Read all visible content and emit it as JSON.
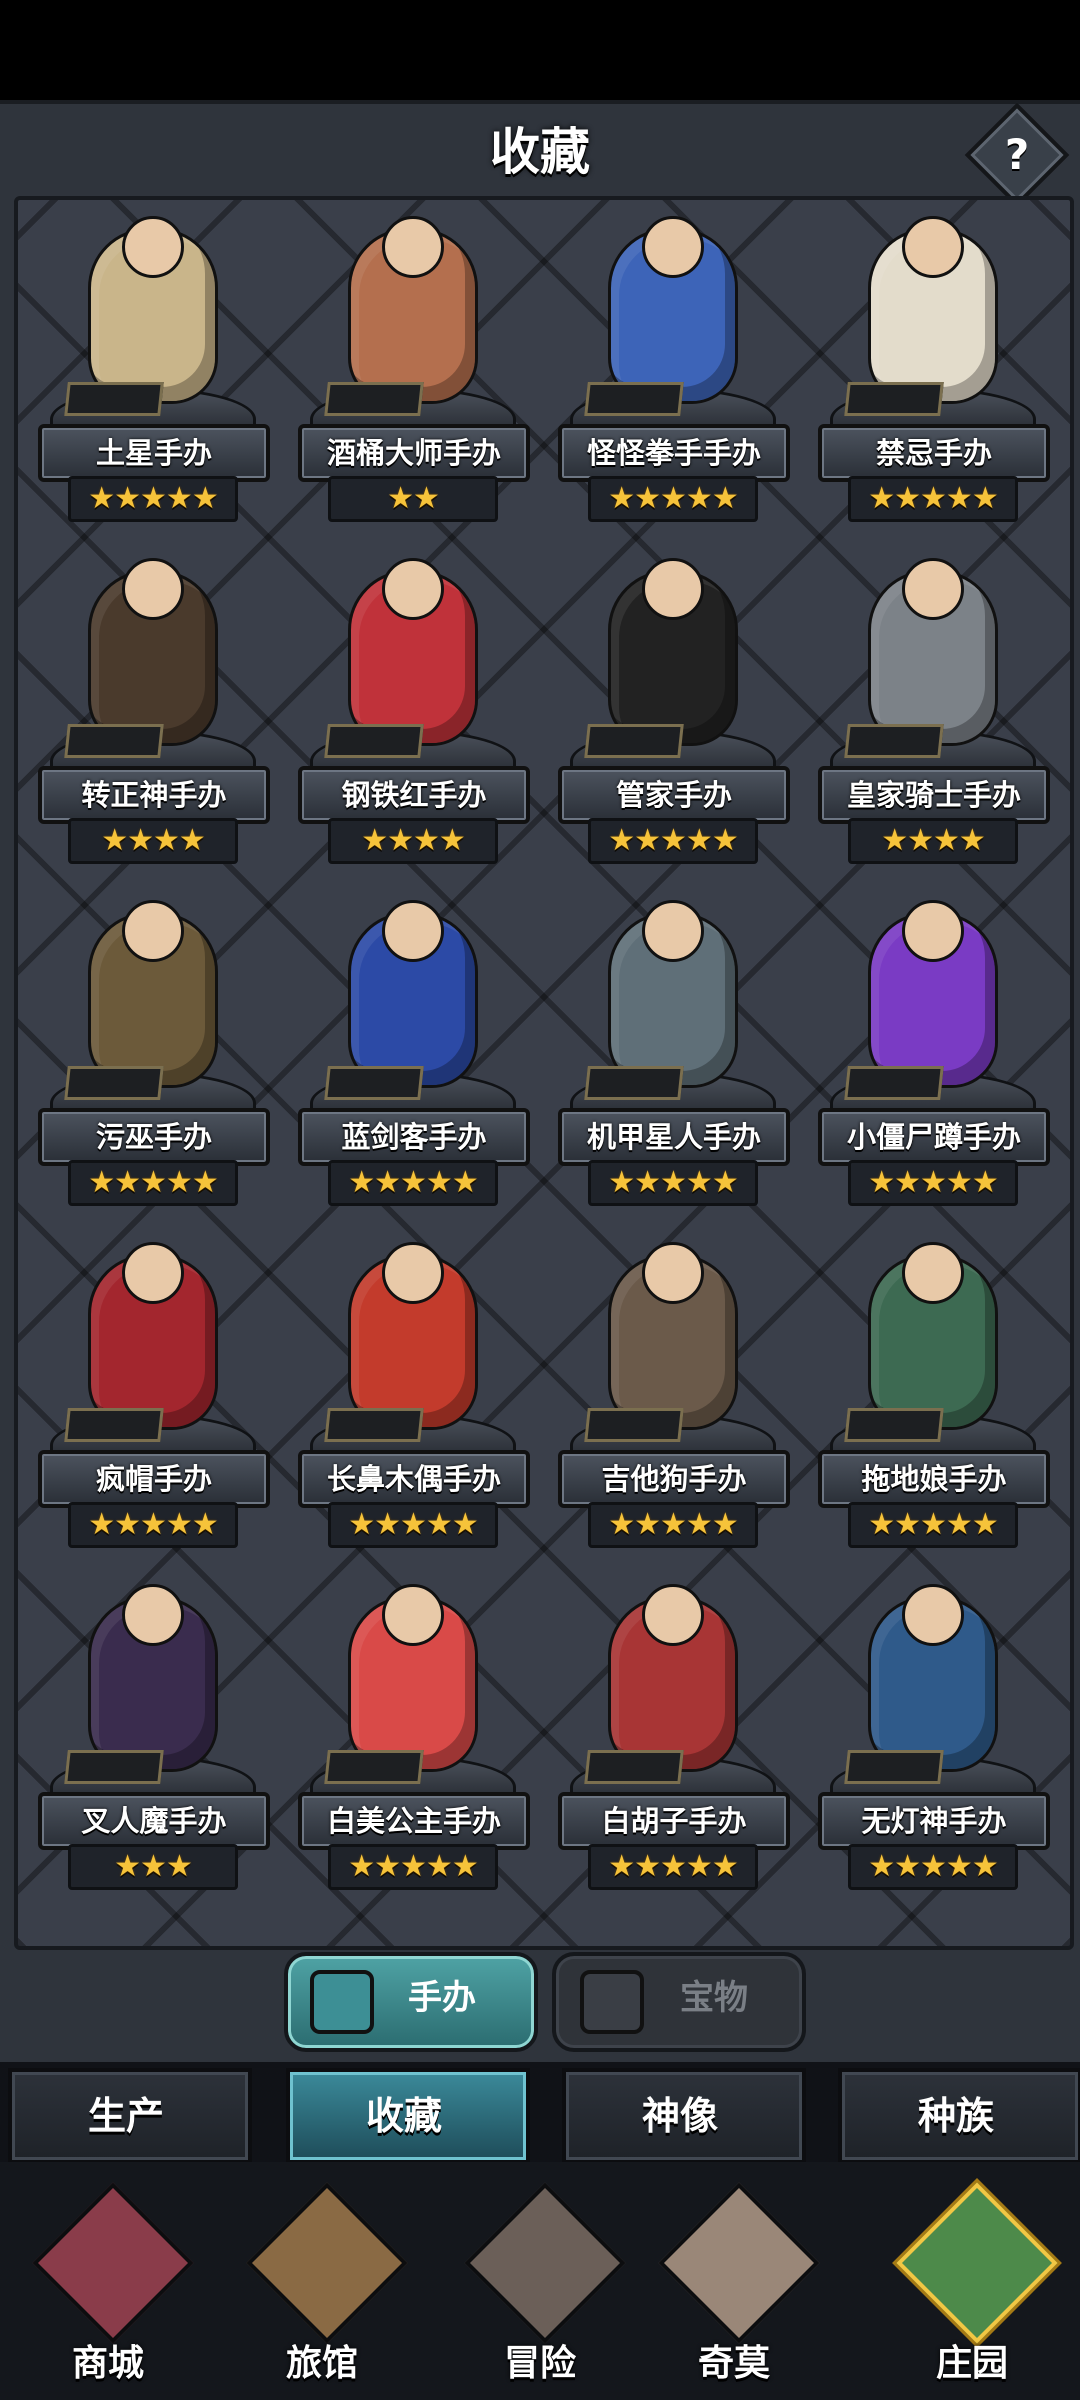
{
  "header": {
    "title": "收藏",
    "help_label": "?"
  },
  "figures": [
    {
      "name": "土星手办",
      "stars": 5,
      "color": "#c9b58a"
    },
    {
      "name": "酒桶大师手办",
      "stars": 2,
      "color": "#b46f4e"
    },
    {
      "name": "怪怪拳手手办",
      "stars": 5,
      "color": "#3d64b8"
    },
    {
      "name": "禁忌手办",
      "stars": 5,
      "color": "#e3dccb"
    },
    {
      "name": "转正神手办",
      "stars": 4,
      "color": "#4a3a2c"
    },
    {
      "name": "钢铁红手办",
      "stars": 4,
      "color": "#c0323a"
    },
    {
      "name": "管家手办",
      "stars": 5,
      "color": "#222222"
    },
    {
      "name": "皇家骑士手办",
      "stars": 4,
      "color": "#7c8288"
    },
    {
      "name": "污巫手办",
      "stars": 5,
      "color": "#6c5a3a"
    },
    {
      "name": "蓝剑客手办",
      "stars": 5,
      "color": "#2c4aa6"
    },
    {
      "name": "机甲星人手办",
      "stars": 5,
      "color": "#5f6f78"
    },
    {
      "name": "小僵尸蹲手办",
      "stars": 5,
      "color": "#7a3bc4"
    },
    {
      "name": "疯帽手办",
      "stars": 5,
      "color": "#a3262e"
    },
    {
      "name": "长鼻木偶手办",
      "stars": 5,
      "color": "#c33b2c"
    },
    {
      "name": "吉他狗手办",
      "stars": 5,
      "color": "#6b5a4a"
    },
    {
      "name": "拖地娘手办",
      "stars": 5,
      "color": "#3d6a52"
    },
    {
      "name": "叉人魔手办",
      "stars": 3,
      "color": "#3a2c4e"
    },
    {
      "name": "白美公主手办",
      "stars": 5,
      "color": "#d94a48"
    },
    {
      "name": "白胡子手办",
      "stars": 5,
      "color": "#a83535"
    },
    {
      "name": "无灯神手办",
      "stars": 5,
      "color": "#2f5a8a"
    }
  ],
  "tabs": {
    "figures_label": "手办",
    "treasure_label": "宝物"
  },
  "subnav": [
    "生产",
    "收藏",
    "神像",
    "种族"
  ],
  "bottom_nav": [
    "商城",
    "旅馆",
    "冒险",
    "奇莫",
    "庄园"
  ],
  "colors": {
    "accent": "#2b6c70",
    "star": "#f6c33a"
  }
}
